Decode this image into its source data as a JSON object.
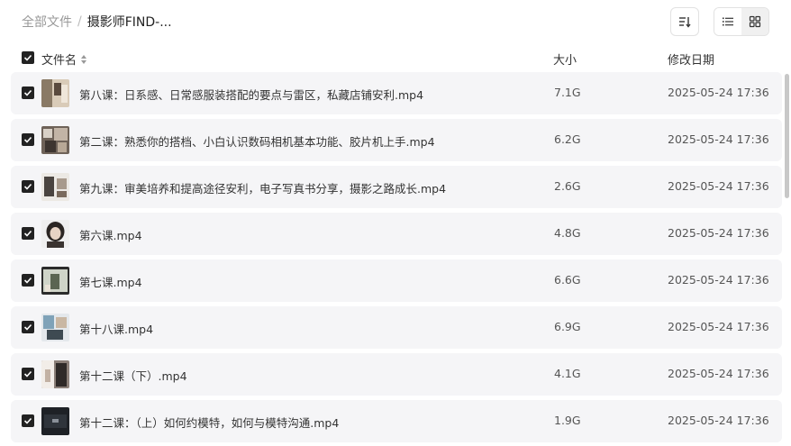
{
  "breadcrumb": {
    "root": "全部文件",
    "separator": "/",
    "current": "摄影师FIND-..."
  },
  "toolbar": {
    "sort_icon": "sort-icon",
    "list_view_icon": "list-view-icon",
    "grid_view_icon": "grid-view-icon"
  },
  "columns": {
    "name": "文件名",
    "size": "大小",
    "date": "修改日期"
  },
  "files": [
    {
      "name": "第八课：日系感、日常感服装搭配的要点与雷区，私藏店铺安利.mp4",
      "size": "7.1G",
      "date": "2025-05-24 17:36",
      "checked": true
    },
    {
      "name": "第二课：熟悉你的搭档、小白认识数码相机基本功能、胶片机上手.mp4",
      "size": "6.2G",
      "date": "2025-05-24 17:36",
      "checked": true
    },
    {
      "name": "第九课：审美培养和提高途径安利，电子写真书分享，摄影之路成长.mp4",
      "size": "2.6G",
      "date": "2025-05-24 17:36",
      "checked": true
    },
    {
      "name": "第六课.mp4",
      "size": "4.8G",
      "date": "2025-05-24 17:36",
      "checked": true
    },
    {
      "name": "第七课.mp4",
      "size": "6.6G",
      "date": "2025-05-24 17:36",
      "checked": true
    },
    {
      "name": "第十八课.mp4",
      "size": "6.9G",
      "date": "2025-05-24 17:36",
      "checked": true
    },
    {
      "name": "第十二课（下）.mp4",
      "size": "4.1G",
      "date": "2025-05-24 17:36",
      "checked": true
    },
    {
      "name": "第十二课：（上）如何约模特，如何与模特沟通.mp4",
      "size": "1.9G",
      "date": "2025-05-24 17:36",
      "checked": true
    }
  ],
  "colors": {
    "row_bg": "#f5f5f7",
    "checkbox": "#222222",
    "muted_text": "#999999"
  }
}
